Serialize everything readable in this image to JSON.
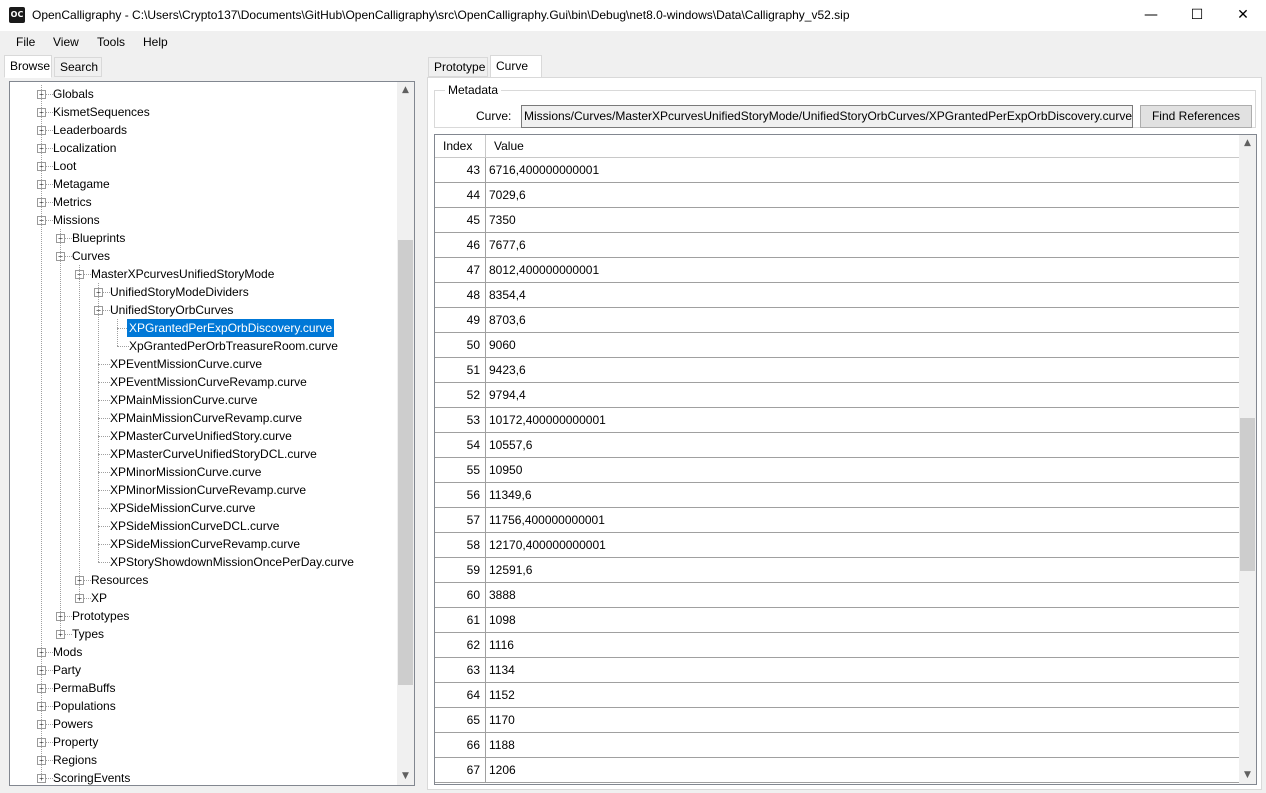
{
  "window": {
    "title": "OpenCalligraphy - C:\\Users\\Crypto137\\Documents\\GitHub\\OpenCalligraphy\\src\\OpenCalligraphy.Gui\\bin\\Debug\\net8.0-windows\\Data\\Calligraphy_v52.sip",
    "icon_text": "OC",
    "minimize_glyph": "—",
    "maximize_glyph": "☐",
    "close_glyph": "✕"
  },
  "menu": [
    "File",
    "View",
    "Tools",
    "Help"
  ],
  "left_tabs": [
    "Browse",
    "Search"
  ],
  "right_tabs": [
    "Prototype",
    "Curve"
  ],
  "tree": [
    {
      "label": "Globals",
      "depth": 0,
      "expander": "+"
    },
    {
      "label": "KismetSequences",
      "depth": 0,
      "expander": "+"
    },
    {
      "label": "Leaderboards",
      "depth": 0,
      "expander": "+"
    },
    {
      "label": "Localization",
      "depth": 0,
      "expander": "+"
    },
    {
      "label": "Loot",
      "depth": 0,
      "expander": "+"
    },
    {
      "label": "Metagame",
      "depth": 0,
      "expander": "+"
    },
    {
      "label": "Metrics",
      "depth": 0,
      "expander": "+"
    },
    {
      "label": "Missions",
      "depth": 0,
      "expander": "−"
    },
    {
      "label": "Blueprints",
      "depth": 1,
      "expander": "+"
    },
    {
      "label": "Curves",
      "depth": 1,
      "expander": "−"
    },
    {
      "label": "MasterXPcurvesUnifiedStoryMode",
      "depth": 2,
      "expander": "−"
    },
    {
      "label": "UnifiedStoryModeDividers",
      "depth": 3,
      "expander": "+"
    },
    {
      "label": "UnifiedStoryOrbCurves",
      "depth": 3,
      "expander": "−"
    },
    {
      "label": "XPGrantedPerExpOrbDiscovery.curve",
      "depth": 4,
      "expander": "",
      "selected": true
    },
    {
      "label": "XpGrantedPerOrbTreasureRoom.curve",
      "depth": 4,
      "expander": ""
    },
    {
      "label": "XPEventMissionCurve.curve",
      "depth": 3,
      "expander": ""
    },
    {
      "label": "XPEventMissionCurveRevamp.curve",
      "depth": 3,
      "expander": ""
    },
    {
      "label": "XPMainMissionCurve.curve",
      "depth": 3,
      "expander": ""
    },
    {
      "label": "XPMainMissionCurveRevamp.curve",
      "depth": 3,
      "expander": ""
    },
    {
      "label": "XPMasterCurveUnifiedStory.curve",
      "depth": 3,
      "expander": ""
    },
    {
      "label": "XPMasterCurveUnifiedStoryDCL.curve",
      "depth": 3,
      "expander": ""
    },
    {
      "label": "XPMinorMissionCurve.curve",
      "depth": 3,
      "expander": ""
    },
    {
      "label": "XPMinorMissionCurveRevamp.curve",
      "depth": 3,
      "expander": ""
    },
    {
      "label": "XPSideMissionCurve.curve",
      "depth": 3,
      "expander": ""
    },
    {
      "label": "XPSideMissionCurveDCL.curve",
      "depth": 3,
      "expander": ""
    },
    {
      "label": "XPSideMissionCurveRevamp.curve",
      "depth": 3,
      "expander": ""
    },
    {
      "label": "XPStoryShowdownMissionOncePerDay.curve",
      "depth": 3,
      "expander": ""
    },
    {
      "label": "Resources",
      "depth": 2,
      "expander": "+"
    },
    {
      "label": "XP",
      "depth": 2,
      "expander": "+"
    },
    {
      "label": "Prototypes",
      "depth": 1,
      "expander": "+"
    },
    {
      "label": "Types",
      "depth": 1,
      "expander": "+"
    },
    {
      "label": "Mods",
      "depth": 0,
      "expander": "+"
    },
    {
      "label": "Party",
      "depth": 0,
      "expander": "+"
    },
    {
      "label": "PermaBuffs",
      "depth": 0,
      "expander": "+"
    },
    {
      "label": "Populations",
      "depth": 0,
      "expander": "+"
    },
    {
      "label": "Powers",
      "depth": 0,
      "expander": "+"
    },
    {
      "label": "Property",
      "depth": 0,
      "expander": "+"
    },
    {
      "label": "Regions",
      "depth": 0,
      "expander": "+"
    },
    {
      "label": "ScoringEvents",
      "depth": 0,
      "expander": "+"
    }
  ],
  "metadata": {
    "group_title": "Metadata",
    "curve_label": "Curve:",
    "curve_value": "Missions/Curves/MasterXPcurvesUnifiedStoryMode/UnifiedStoryOrbCurves/XPGrantedPerExpOrbDiscovery.curve (i",
    "find_button": "Find References"
  },
  "grid": {
    "headers": {
      "index": "Index",
      "value": "Value"
    },
    "rows": [
      {
        "index": "43",
        "value": "6716,400000000001"
      },
      {
        "index": "44",
        "value": "7029,6"
      },
      {
        "index": "45",
        "value": "7350"
      },
      {
        "index": "46",
        "value": "7677,6"
      },
      {
        "index": "47",
        "value": "8012,400000000001"
      },
      {
        "index": "48",
        "value": "8354,4"
      },
      {
        "index": "49",
        "value": "8703,6"
      },
      {
        "index": "50",
        "value": "9060"
      },
      {
        "index": "51",
        "value": "9423,6"
      },
      {
        "index": "52",
        "value": "9794,4"
      },
      {
        "index": "53",
        "value": "10172,400000000001"
      },
      {
        "index": "54",
        "value": "10557,6"
      },
      {
        "index": "55",
        "value": "10950"
      },
      {
        "index": "56",
        "value": "11349,6"
      },
      {
        "index": "57",
        "value": "11756,400000000001"
      },
      {
        "index": "58",
        "value": "12170,400000000001"
      },
      {
        "index": "59",
        "value": "12591,6"
      },
      {
        "index": "60",
        "value": "3888"
      },
      {
        "index": "61",
        "value": "1098"
      },
      {
        "index": "62",
        "value": "1116"
      },
      {
        "index": "63",
        "value": "1134"
      },
      {
        "index": "64",
        "value": "1152"
      },
      {
        "index": "65",
        "value": "1170"
      },
      {
        "index": "66",
        "value": "1188"
      },
      {
        "index": "67",
        "value": "1206"
      }
    ]
  },
  "scroll": {
    "up_glyph": "▲",
    "down_glyph": "▼"
  },
  "colors": {
    "selection": "#0078d7",
    "window_bg": "#f0f0f0"
  }
}
